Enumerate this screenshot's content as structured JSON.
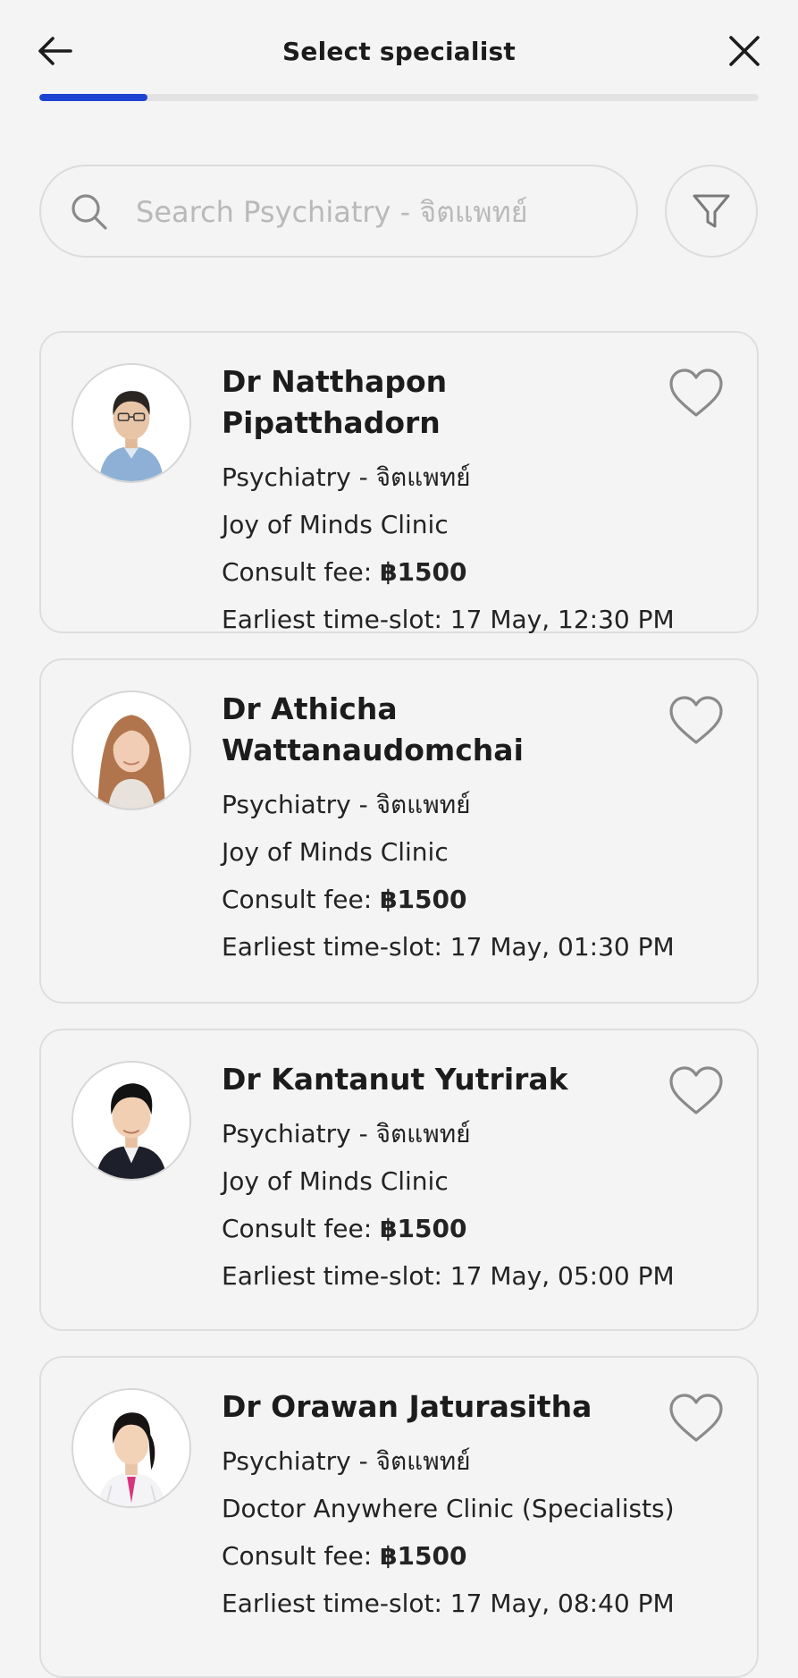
{
  "header": {
    "title": "Select specialist",
    "back_icon": "arrow-left-icon",
    "close_icon": "close-icon"
  },
  "progress": {
    "fraction": 0.15,
    "track_color": "#e2e2e2",
    "fill_color": "#1f43d1"
  },
  "search": {
    "placeholder": "Search Psychiatry - จิตแพทย์",
    "value": "",
    "icon": "search-icon",
    "filter_icon": "filter-icon"
  },
  "doctors": [
    {
      "name": "Dr Natthapon Pipatthadorn",
      "specialty": "Psychiatry - จิตแพทย์",
      "clinic": "Joy of Minds Clinic",
      "fee_label": "Consult fee:",
      "fee_value": "฿1500",
      "slot": "Earliest time-slot: 17 May, 12:30 PM"
    },
    {
      "name": "Dr Athicha Wattanaudomchai",
      "specialty": "Psychiatry - จิตแพทย์",
      "clinic": "Joy of Minds Clinic",
      "fee_label": "Consult fee:",
      "fee_value": "฿1500",
      "slot": "Earliest time-slot: 17 May, 01:30 PM"
    },
    {
      "name": "Dr Kantanut Yutrirak",
      "specialty": "Psychiatry - จิตแพทย์",
      "clinic": "Joy of Minds Clinic",
      "fee_label": "Consult fee:",
      "fee_value": "฿1500",
      "slot": "Earliest time-slot: 17 May, 05:00 PM"
    },
    {
      "name": "Dr Orawan Jaturasitha",
      "specialty": "Psychiatry - จิตแพทย์",
      "clinic": "Doctor Anywhere Clinic (Specialists)",
      "fee_label": "Consult fee:",
      "fee_value": "฿1500",
      "slot": "Earliest time-slot: 17 May, 08:40 PM"
    }
  ],
  "favorite_icon": "heart-outline-icon",
  "colors": {
    "accent": "#1f43d1",
    "background": "#f4f4f4",
    "border": "#dedede",
    "text": "#1c1c1c",
    "placeholder": "#b9b9b9",
    "icon": "#8a8a8a"
  }
}
